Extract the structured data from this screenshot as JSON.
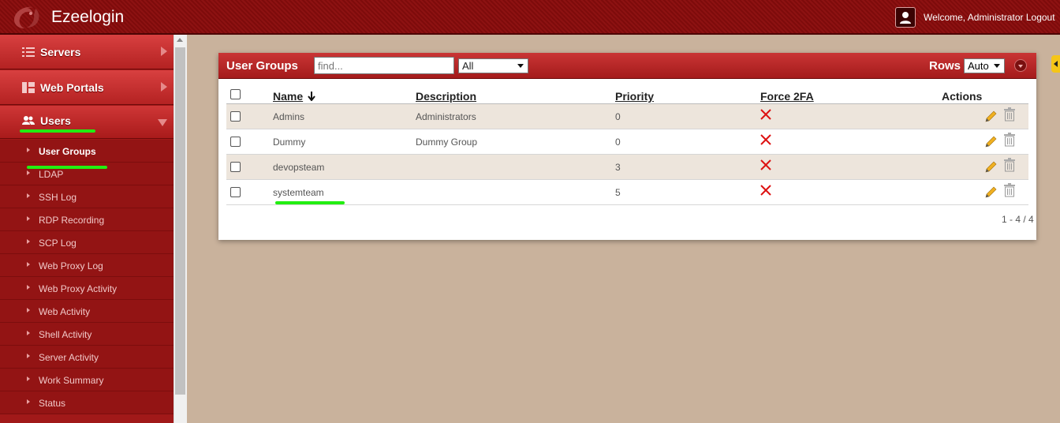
{
  "header": {
    "brand": "Ezeelogin",
    "welcome": "Welcome, Administrator",
    "logout": "Logout"
  },
  "sidebar": {
    "main_items": [
      {
        "label": "Servers",
        "icon": "list-icon",
        "state": "collapsed"
      },
      {
        "label": "Web Portals",
        "icon": "grid-icon",
        "state": "collapsed"
      },
      {
        "label": "Users",
        "icon": "users-icon",
        "state": "expanded"
      }
    ],
    "sub_items": [
      {
        "label": "User Groups",
        "active": true
      },
      {
        "label": "LDAP"
      },
      {
        "label": "SSH Log"
      },
      {
        "label": "RDP Recording"
      },
      {
        "label": "SCP Log"
      },
      {
        "label": "Web Proxy Log"
      },
      {
        "label": "Web Proxy Activity"
      },
      {
        "label": "Web Activity"
      },
      {
        "label": "Shell Activity"
      },
      {
        "label": "Server Activity"
      },
      {
        "label": "Work Summary"
      },
      {
        "label": "Status"
      }
    ]
  },
  "panel": {
    "title": "User Groups",
    "search_placeholder": "find...",
    "filter_value": "All",
    "rows_label": "Rows",
    "rows_value": "Auto",
    "columns": {
      "name": "Name",
      "description": "Description",
      "priority": "Priority",
      "force2fa": "Force 2FA",
      "actions": "Actions"
    },
    "rows": [
      {
        "name": "Admins",
        "description": "Administrators",
        "priority": "0"
      },
      {
        "name": "Dummy",
        "description": "Dummy Group",
        "priority": "0"
      },
      {
        "name": "devopsteam",
        "description": "",
        "priority": "3"
      },
      {
        "name": "systemteam",
        "description": "",
        "priority": "5"
      }
    ],
    "pagination": "1 - 4 / 4"
  },
  "colors": {
    "header_bg": "#8d1212",
    "accent_red": "#b42222",
    "highlight_green": "#22ee11",
    "row_alt": "#ede5dc"
  }
}
